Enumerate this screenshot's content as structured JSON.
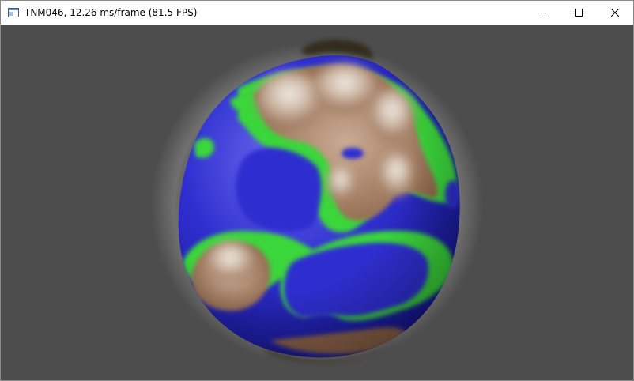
{
  "window": {
    "title": "TNM046, 12.26 ms/frame (81.5 FPS)",
    "icon": "application-window-icon",
    "controls": [
      "minimize-icon",
      "maximize-icon",
      "close-icon"
    ]
  },
  "viewport": {
    "background_color": "#4d4d4d",
    "scene": "procedurally-generated-planet",
    "colors": {
      "ocean": "#2a2ac8",
      "shore": "#38d838",
      "land": "#a77a5c",
      "peak": "#ece6de",
      "shadow": "#2f2519"
    }
  }
}
